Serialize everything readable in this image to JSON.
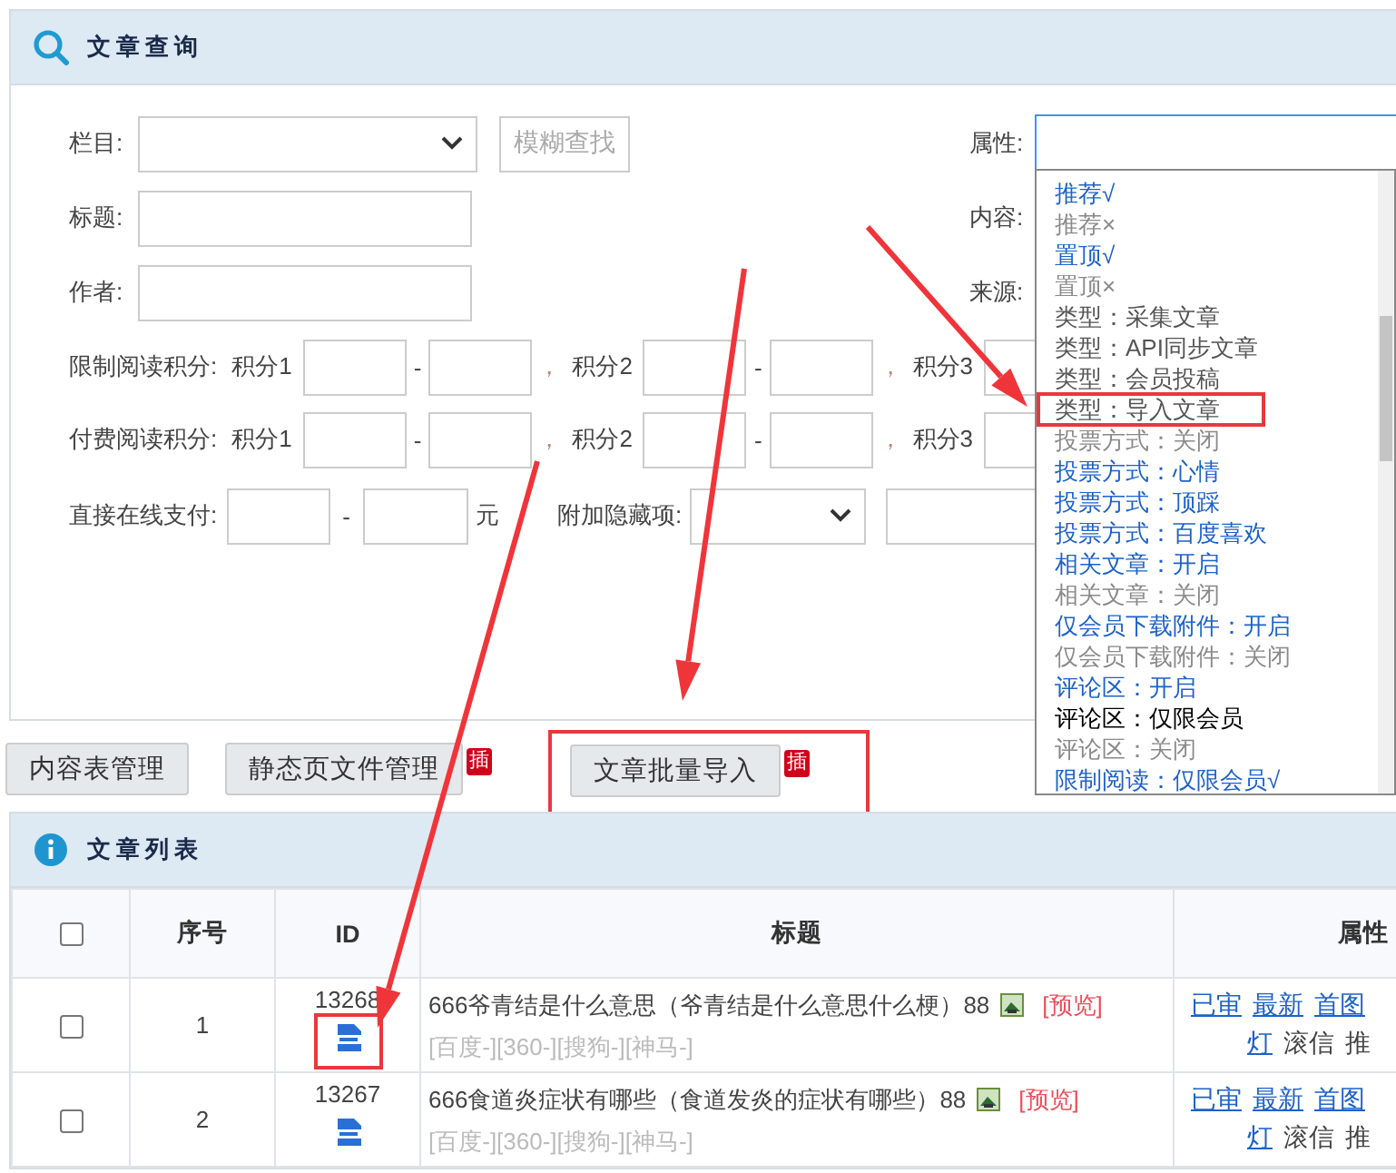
{
  "query_panel": {
    "title": "文章查询",
    "category": {
      "label": "栏目:"
    },
    "fuzzy_button": "模糊查找",
    "title_field": {
      "label": "标题:"
    },
    "author_field": {
      "label": "作者:"
    },
    "right_labels": [
      "属性:",
      "内容:",
      "来源:"
    ],
    "limit_points": {
      "label": "限制阅读积分:",
      "parts": [
        "积分1",
        "积分2",
        "积分3"
      ],
      "dash": "-",
      "comma": "，"
    },
    "paid_points": {
      "label": "付费阅读积分:",
      "parts": [
        "积分1",
        "积分2",
        "积分3"
      ],
      "dash": "-",
      "comma": "，"
    },
    "direct_pay": {
      "label": "直接在线支付:",
      "dash": "-",
      "unit": "元"
    },
    "hidden_item": {
      "label": "附加隐藏项:"
    }
  },
  "attribute_dropdown": {
    "expanded": true,
    "options": [
      {
        "label": "推荐√",
        "color": "#1e62c8"
      },
      {
        "label": "推荐×",
        "color": "#8a8a8a"
      },
      {
        "label": "置顶√",
        "color": "#1e62c8"
      },
      {
        "label": "置顶×",
        "color": "#8a8a8a"
      },
      {
        "label": "类型：采集文章",
        "color": "#555555"
      },
      {
        "label": "类型：API同步文章",
        "color": "#555555"
      },
      {
        "label": "类型：会员投稿",
        "color": "#555555"
      },
      {
        "label": "类型：导入文章",
        "color": "#555555",
        "highlighted": true
      },
      {
        "label": "投票方式：关闭",
        "color": "#8a8a8a"
      },
      {
        "label": "投票方式：心情",
        "color": "#1e62c8"
      },
      {
        "label": "投票方式：顶踩",
        "color": "#1e62c8"
      },
      {
        "label": "投票方式：百度喜欢",
        "color": "#1e62c8"
      },
      {
        "label": "相关文章：开启",
        "color": "#1e62c8"
      },
      {
        "label": "相关文章：关闭",
        "color": "#8a8a8a"
      },
      {
        "label": "仅会员下载附件：开启",
        "color": "#1e62c8"
      },
      {
        "label": "仅会员下载附件：关闭",
        "color": "#8a8a8a"
      },
      {
        "label": "评论区：开启",
        "color": "#1e62c8"
      },
      {
        "label": "评论区：仅限会员",
        "color": "#000000"
      },
      {
        "label": "评论区：关闭",
        "color": "#8a8a8a"
      },
      {
        "label": "限制阅读：仅限会员√",
        "color": "#1e62c8"
      }
    ]
  },
  "action_buttons": [
    {
      "label": "内容表管理",
      "highlighted": false
    },
    {
      "label": "静态页文件管理",
      "badge": "插",
      "highlighted": false
    },
    {
      "label": "文章批量导入",
      "badge": "插",
      "highlighted": true
    }
  ],
  "list_panel": {
    "title": "文章列表"
  },
  "table": {
    "select_all_checked": false,
    "columns": [
      "序号",
      "ID",
      "标题",
      "属性"
    ],
    "rows": [
      {
        "checked": false,
        "index": "1",
        "id": "13268",
        "id_highlighted": true,
        "title": "666爷青结是什么意思（爷青结是什么意思什么梗）88",
        "preview": "[预览]",
        "engines": "[百度-][360-][搜狗-][神马-]",
        "attrs_line1": [
          "已审",
          "最新",
          "首图"
        ],
        "attrs_line2": [
          "灯",
          "滚信",
          "推"
        ]
      },
      {
        "checked": false,
        "index": "2",
        "id": "13267",
        "id_highlighted": false,
        "title": "666食道炎症状有哪些（食道发炎的症状有哪些）88",
        "preview": "[预览]",
        "engines": "[百度-][360-][搜狗-][神马-]",
        "attrs_line1": [
          "已审",
          "最新",
          "首图"
        ],
        "attrs_line2": [
          "灯",
          "滚信",
          "推"
        ]
      }
    ]
  }
}
